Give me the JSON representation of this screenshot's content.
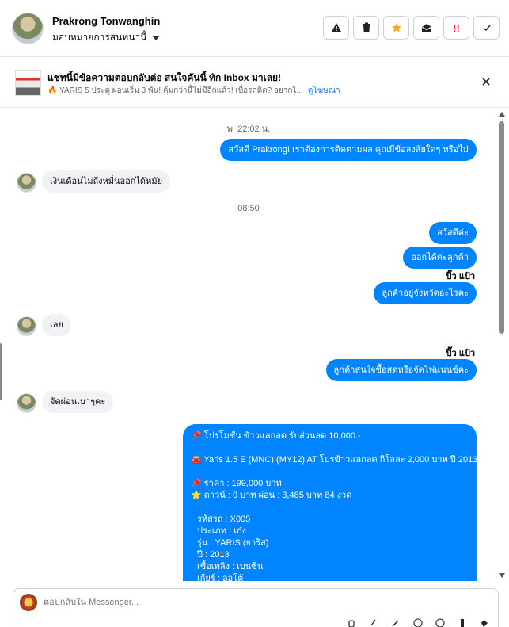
{
  "header": {
    "contact_name": "Prakrong Tonwanghin",
    "assign_label": "มอบหมายการสนทนานี้",
    "actions": [
      "warning-icon",
      "trash-icon",
      "star-icon",
      "envelope-open-icon",
      "urgent-icon",
      "check-icon"
    ],
    "urgent_glyph": "!!"
  },
  "banner": {
    "title": "แชทนี้มีข้อความตอบกลับต่อ สนใจคันนี้ ทัก Inbox มาเลย!",
    "subtitle": "🔥 YARIS 5 ประตู ผ่อนเริ่ม 3 พัน! คุ้มกว่านี้ไม่มีอีกแล้ว! เบื่อรถติด? อยากไ...",
    "link": "ดูโฆษณา"
  },
  "messages": {
    "time1": "พ. 22:02 น.",
    "out1": "สวัสดี Prakrong! เราต้องการติดตามผล คุณมีข้อสงสัยใดๆ หรือไม่",
    "in1": "เงินเดือนไม่ถึงหมื่นออกได้หมัย",
    "time2": "08:50",
    "out2": "สวัสดีค่ะ",
    "out3": "ออกได้ค่ะลูกค้า",
    "sender1": "ปิ๊ว แป้ว",
    "out4": "ลูกค้าอยู่จังหวัดอะไรคะ",
    "in2": "เลย",
    "sender2": "ปิ๊ว แป้ว",
    "out5": "ลูกค้าสนใจซื้อสดหรือจัดไฟแนนซ์คะ",
    "in3": "จัดผ่อนเบาๆคะ"
  },
  "promo": {
    "l1": "📌 โปรโมชั่น ข้าวแลกลด รับส่วนลด 10,000.-",
    "l2": "🚘 Yaris 1.5 E (MNC) (MY12) AT โปรข้าวแลกลด กิโลละ 2,000 บาท ปี 2013",
    "l3": "📌 ราคา : 199,000 บาท",
    "l4": "⭐ ดาวน์ : 0 บาท ผ่อน : 3,485 บาท 84 งวด",
    "l5": "รหัสรถ : X005",
    "l6": "ประเภท : เก๋ง",
    "l7": "รุ่น : YARIS (ยาริส)",
    "l8": "ปี : 2013",
    "l9": "เชื้อเพลิง : เบนซิน",
    "l10": "เกียร์ : ออโต้"
  },
  "composer": {
    "placeholder": "ตอบกลับใน Messenger..."
  },
  "colors": {
    "accent": "#0084ff",
    "link": "#1877f2",
    "incoming_bg": "#f0f2f5"
  }
}
